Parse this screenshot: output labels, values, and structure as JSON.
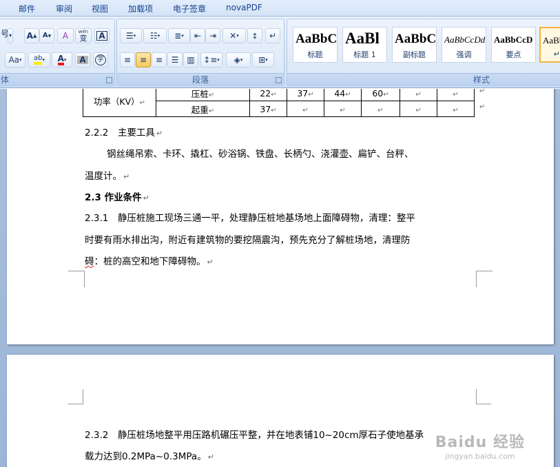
{
  "tabs": [
    "邮件",
    "审阅",
    "视图",
    "加载项",
    "电子签章",
    "novaPDF"
  ],
  "ribbon": {
    "font_group": {
      "label": "体",
      "grow_font": "A",
      "shrink_font": "A",
      "clear_format": "A",
      "phonetic_guide": "wén",
      "phonetic_char": "变",
      "char_border": "A",
      "change_case": "Aa",
      "highlight": "ab",
      "font_color": "A",
      "char_shading": "A",
      "enclose_char": "字",
      "partial_label": "号"
    },
    "paragraph_group": {
      "label": "段落"
    },
    "styles_group": {
      "label": "样式",
      "styles": [
        {
          "sample": "AaBbC",
          "caption": "标题"
        },
        {
          "sample": "AaBl",
          "caption": "标题 1"
        },
        {
          "sample": "AaBbC",
          "caption": "副标题"
        },
        {
          "sample": "AaBbCcDd",
          "caption": "强调"
        },
        {
          "sample": "AaBbCcD",
          "caption": "要点"
        },
        {
          "sample": "AaBb",
          "caption": "↵ 正"
        }
      ]
    }
  },
  "document": {
    "table": {
      "row_header": "功率（KV）",
      "rows": [
        {
          "name": "压桩",
          "values": [
            "22",
            "37",
            "44",
            "60",
            "",
            ""
          ]
        },
        {
          "name": "起重",
          "values": [
            "37",
            "",
            "",
            "",
            "",
            ""
          ]
        }
      ]
    },
    "heading_222": "2.2.2　主要工具",
    "tools_line1": "钢丝绳吊索、卡环、撬杠、砂浴锅、铁盘、长柄勺、浇灌壶、扁铲、台秤、",
    "tools_line2": "温度计。",
    "heading_23": "2.3 作业条件",
    "p231_line1": "2.3.1　静压桩施工现场三通一平，处理静压桩地基场地上面障碍物，清理：整平",
    "p231_line2": "时要有雨水排出沟，附近有建筑物的要挖隔震沟，预先充分了解桩场地，清理防",
    "p231_line3_a": "碍",
    "p231_line3_b": "：桩的高空和地下障碍物。",
    "p232_line1": "2.3.2　静压桩场地整平用压路机碾压平整，并在地表铺10~20cm厚石子使地基承",
    "p232_line2": "载力达到0.2MPa~0.3MPa。",
    "para_mark": "↵"
  },
  "watermark": {
    "title": "Baidu 经验",
    "url": "jingyan.baidu.com"
  }
}
